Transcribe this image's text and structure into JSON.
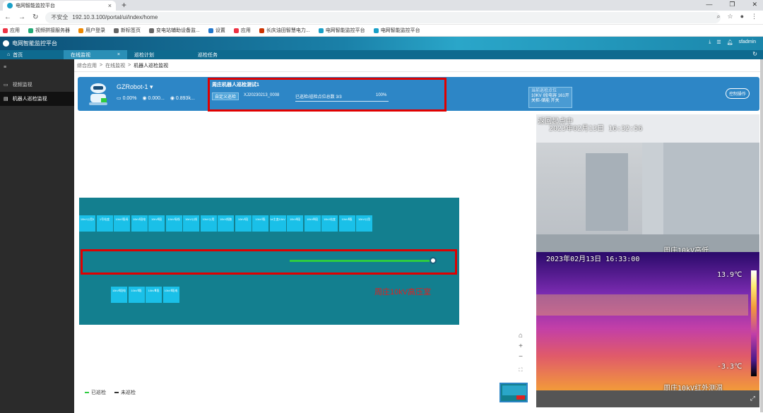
{
  "browser": {
    "tab_title": "电网智能监控平台",
    "url_security": "不安全",
    "url": "192.10.3.100/portal/ui/index/home",
    "bookmarks": [
      "应用",
      "视频拼接服务器",
      "用户登录",
      "新标签页",
      "变电站辅助设备监...",
      "设置",
      "应用",
      "长庆油田智慧电力...",
      "电网智能监控平台",
      "电网智能监控平台"
    ]
  },
  "app": {
    "title": "电网智能监控平台",
    "user": "sfadmin",
    "tabs": [
      "首页",
      "在线监视",
      "巡检计划",
      "巡检任务"
    ]
  },
  "sidebar": {
    "items": [
      "视频监视",
      "机器人巡检监视"
    ]
  },
  "breadcrumb": [
    "综合应用",
    "在线监视",
    "机器人巡检监视"
  ],
  "robot": {
    "name": "GZRobot-1",
    "stat1": "0.00%",
    "stat2": "0.000...",
    "stat3": "0.893k..."
  },
  "task": {
    "name": "周庄机器人巡检测试1",
    "tag": "自定义巡检",
    "id": "XJ20230213_0008",
    "progress_label": "已巡检/巡检点位总数",
    "progress_count": "3/3",
    "progress_percent": "100%",
    "current_label": "当前巡检点位",
    "current_value": "10KV I段电容 161开关柜-储能 开关"
  },
  "control_button": "控制操作",
  "map": {
    "top_cabinets": [
      "10kV公用3",
      "1号站变",
      "10kVⅠ段母",
      "10kVⅠ段电",
      "10kVⅡ段",
      "10kV母线",
      "10kV公线",
      "10kV公用",
      "10kV线路",
      "10kVⅠ段",
      "10kVⅠ段",
      "1#主变10kV",
      "10kVⅡ段",
      "10kVⅢ段",
      "10kV站变",
      "10kVⅡ段",
      "10kV公用"
    ],
    "bottom_cabinets": [
      "10kVⅡ段电",
      "10kVⅡ段",
      "10kVⅢ段",
      "10kVⅡ段电"
    ],
    "room_label": "周庄10kV高压室",
    "progress": 1.0
  },
  "legend": {
    "done": "已巡检",
    "todo": "未巡检"
  },
  "camera1": {
    "status": "返回起点中",
    "timestamp": "2023年02月13日  16:32:56",
    "caption": "周庄10kV高低"
  },
  "camera2": {
    "timestamp": "2023年02月13日  16:33:00",
    "temp_high": "13.9℃",
    "temp_low": "-3.3℃",
    "caption": "周庄10kV红外测温"
  },
  "colors": {
    "accent": "#2d86c6",
    "highlight": "#e00000",
    "map_bg": "#137f8f",
    "cabinet": "#1ac0e8",
    "track": "#2ecc40"
  }
}
